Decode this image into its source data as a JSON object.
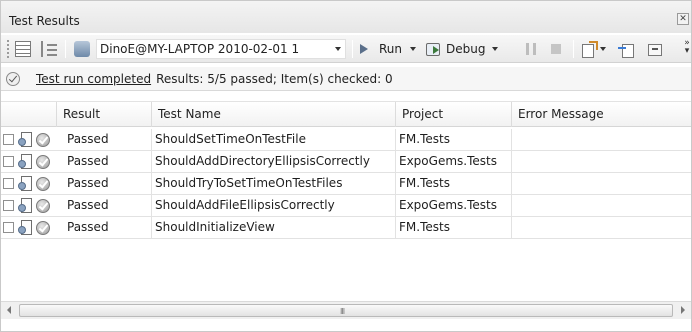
{
  "window": {
    "title": "Test Results"
  },
  "toolbar": {
    "run_config": "DinoE@MY-LAPTOP 2010-02-01 1",
    "run_label": "Run",
    "debug_label": "Debug"
  },
  "status": {
    "link": "Test run completed",
    "summary": "Results: 5/5 passed;  Item(s) checked: 0"
  },
  "grid": {
    "columns": [
      "Result",
      "Test Name",
      "Project",
      "Error Message"
    ],
    "rows": [
      {
        "result": "Passed",
        "name": "ShouldSetTimeOnTestFile",
        "project": "FM.Tests",
        "error": ""
      },
      {
        "result": "Passed",
        "name": "ShouldAddDirectoryEllipsisCorrectly",
        "project": "ExpoGems.Tests",
        "error": ""
      },
      {
        "result": "Passed",
        "name": "ShouldTryToSetTimeOnTestFiles",
        "project": "FM.Tests",
        "error": ""
      },
      {
        "result": "Passed",
        "name": "ShouldAddFileEllipsisCorrectly",
        "project": "ExpoGems.Tests",
        "error": ""
      },
      {
        "result": "Passed",
        "name": "ShouldInitializeView",
        "project": "FM.Tests",
        "error": ""
      }
    ]
  },
  "scrollbar": {
    "grip": "III"
  },
  "icons": [
    "close-icon",
    "group-by-icon",
    "tree-view-icon",
    "run-config-icon",
    "run-icon",
    "debug-icon",
    "pause-icon",
    "stop-icon",
    "export-icon",
    "import-icon",
    "publish-icon",
    "check-circle-icon",
    "test-file-icon",
    "passed-icon"
  ]
}
